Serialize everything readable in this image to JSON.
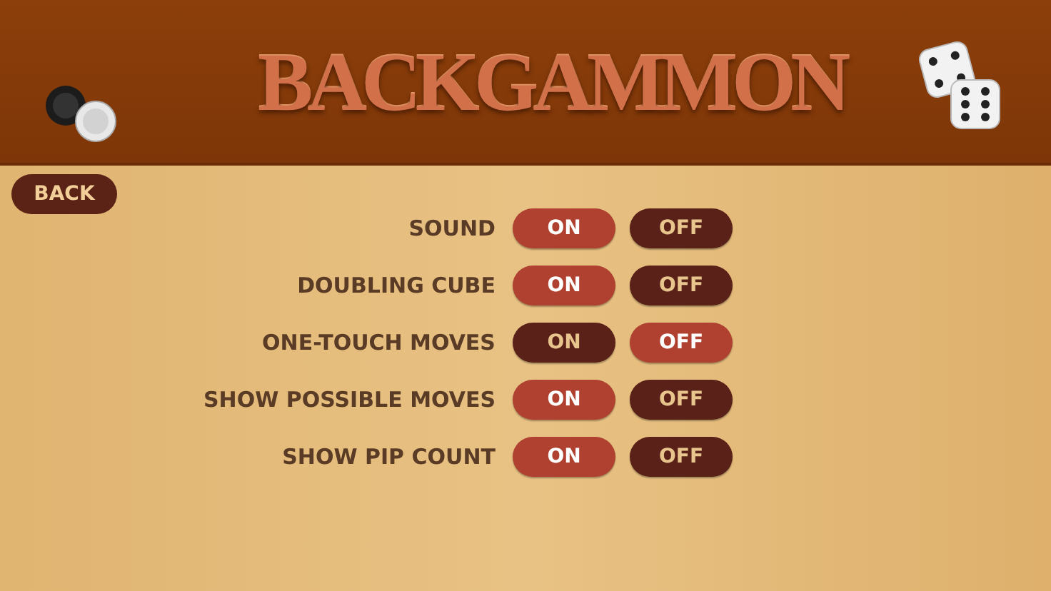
{
  "header": {
    "title": "BACKGAMMON"
  },
  "back_button": {
    "label": "BACK"
  },
  "settings": [
    {
      "label": "SOUND",
      "options": [
        {
          "label": "ON",
          "selected": true
        },
        {
          "label": "OFF",
          "selected": false
        }
      ]
    },
    {
      "label": "DOUBLING CUBE",
      "options": [
        {
          "label": "ON",
          "selected": true
        },
        {
          "label": "OFF",
          "selected": false
        }
      ]
    },
    {
      "label": "ONE-TOUCH MOVES",
      "options": [
        {
          "label": "ON",
          "selected": false
        },
        {
          "label": "OFF",
          "selected": true
        }
      ]
    },
    {
      "label": "SHOW POSSIBLE MOVES",
      "options": [
        {
          "label": "ON",
          "selected": true
        },
        {
          "label": "OFF",
          "selected": false
        }
      ]
    },
    {
      "label": "SHOW PIP COUNT",
      "options": [
        {
          "label": "ON",
          "selected": true
        },
        {
          "label": "OFF",
          "selected": false
        }
      ]
    }
  ]
}
